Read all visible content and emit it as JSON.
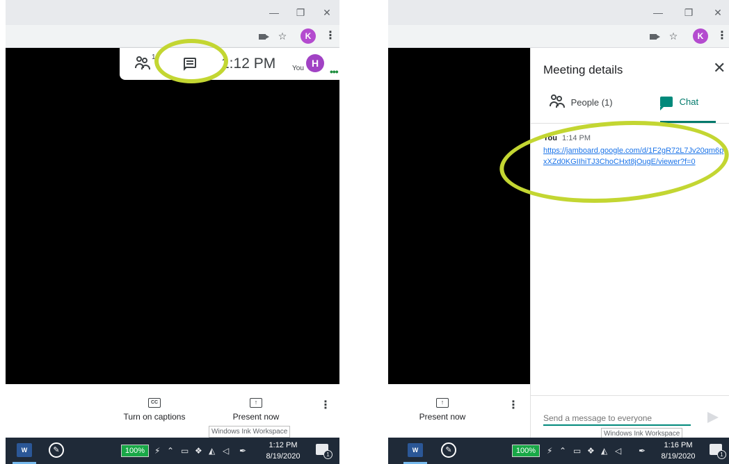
{
  "left": {
    "window_controls": {
      "minimize": "—",
      "restore": "❐",
      "close": "✕"
    },
    "toolbar": {
      "star": "☆",
      "profile_initial": "K",
      "menu": "⋮"
    },
    "meet_topbar": {
      "people_count": "1",
      "time": "1:12 PM",
      "you_label": "You",
      "self_initial": "H",
      "more": "•••"
    },
    "controls": {
      "captions_icon": "CC",
      "captions_label": "Turn on captions",
      "present_icon": "↑",
      "present_label": "Present now",
      "more": "⋮"
    },
    "tooltip": "Windows Ink Workspace",
    "taskbar": {
      "word_icon": "W",
      "battery": "100%",
      "time": "1:12 PM",
      "date": "8/19/2020",
      "notifications": "1"
    }
  },
  "right": {
    "window_controls": {
      "minimize": "—",
      "restore": "❐",
      "close": "✕"
    },
    "toolbar": {
      "star": "☆",
      "profile_initial": "K",
      "menu": "⋮"
    },
    "side_panel": {
      "title": "Meeting details",
      "close": "✕",
      "tabs": [
        {
          "label": "People (1)"
        },
        {
          "label": "Chat"
        }
      ],
      "message": {
        "sender": "You",
        "time": "1:14 PM",
        "text": "https://jamboard.google.com/d/1F2gR72L7Jv20qm6pxXZd0KGIIhiTJ3ChoCHxt8jOugE/viewer?f=0"
      },
      "compose_placeholder": "Send a message to everyone"
    },
    "controls": {
      "present_icon": "↑",
      "present_label": "Present now",
      "more": "⋮"
    },
    "tooltip": "Windows Ink Workspace",
    "taskbar": {
      "word_icon": "W",
      "battery": "100%",
      "time": "1:16 PM",
      "date": "8/19/2020",
      "notifications": "1"
    }
  },
  "colors": {
    "highlight": "#c3d632",
    "chat_accent": "#00796b",
    "link": "#1a73e8",
    "avatar": "#a142c4"
  }
}
